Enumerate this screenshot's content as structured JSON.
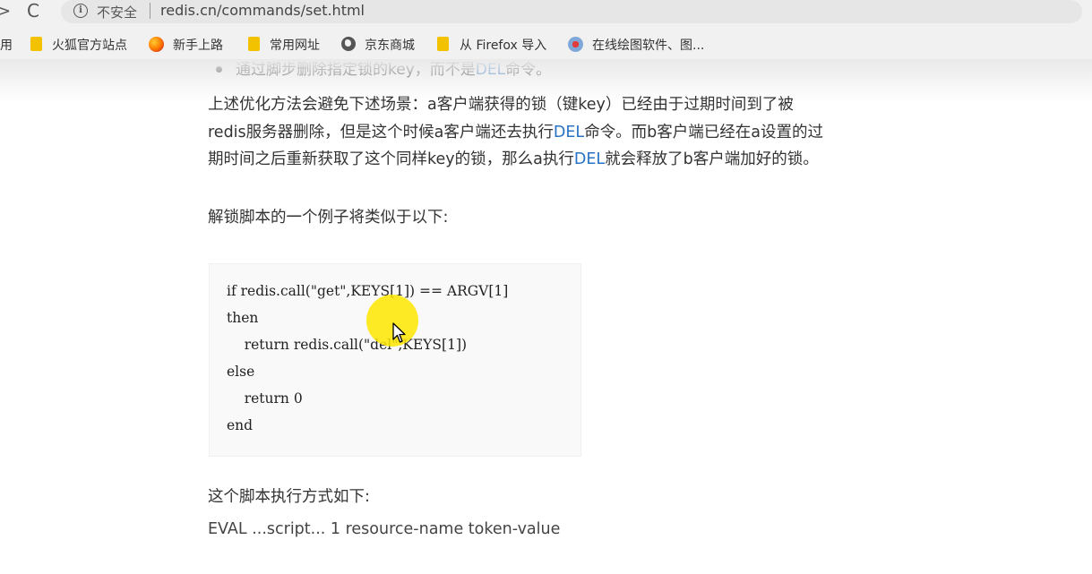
{
  "browser": {
    "back_glyph": ">",
    "reload_glyph": "C",
    "security_label": "不安全",
    "url": "redis.cn/commands/set.html",
    "bookmarks": [
      {
        "label": "用",
        "icon": "none"
      },
      {
        "label": "火狐官方站点",
        "icon": "folder-icon"
      },
      {
        "label": "新手上路",
        "icon": "firefox-icon"
      },
      {
        "label": "常用网址",
        "icon": "folder-icon"
      },
      {
        "label": "京东商城",
        "icon": "globe-icon"
      },
      {
        "label": "从 Firefox 导入",
        "icon": "folder-icon"
      },
      {
        "label": "在线绘图软件、图...",
        "icon": "draw-icon"
      }
    ]
  },
  "content": {
    "list_item": {
      "before": "通过脚步删除指定锁的key，而不是",
      "link": "DEL",
      "after": "命令。"
    },
    "paragraph1": {
      "part1": "上述优化方法会避免下述场景：a客户端获得的锁（键key）已经由于过期时间到了被redis服务器删除，但是这个时候a客户端还去执行",
      "link1": "DEL",
      "part2": "命令。而b客户端已经在a设置的过期时间之后重新获取了这个同样key的锁，那么a执行",
      "link2": "DEL",
      "part3": "就会释放了b客户端加好的锁。"
    },
    "example_intro": "解锁脚本的一个例子将类似于以下:",
    "code_lines": [
      "if redis.call(\"get\",KEYS[1]) == ARGV[1]",
      "then",
      "    return redis.call(\"del\",KEYS[1])",
      "else",
      "    return 0",
      "end"
    ],
    "exec_intro": "这个脚本执行方式如下:",
    "exec_command": "EVAL ...script... 1 resource-name token-value"
  },
  "colors": {
    "link": "#2a73c4",
    "cursor_highlight": "#ffe600"
  }
}
